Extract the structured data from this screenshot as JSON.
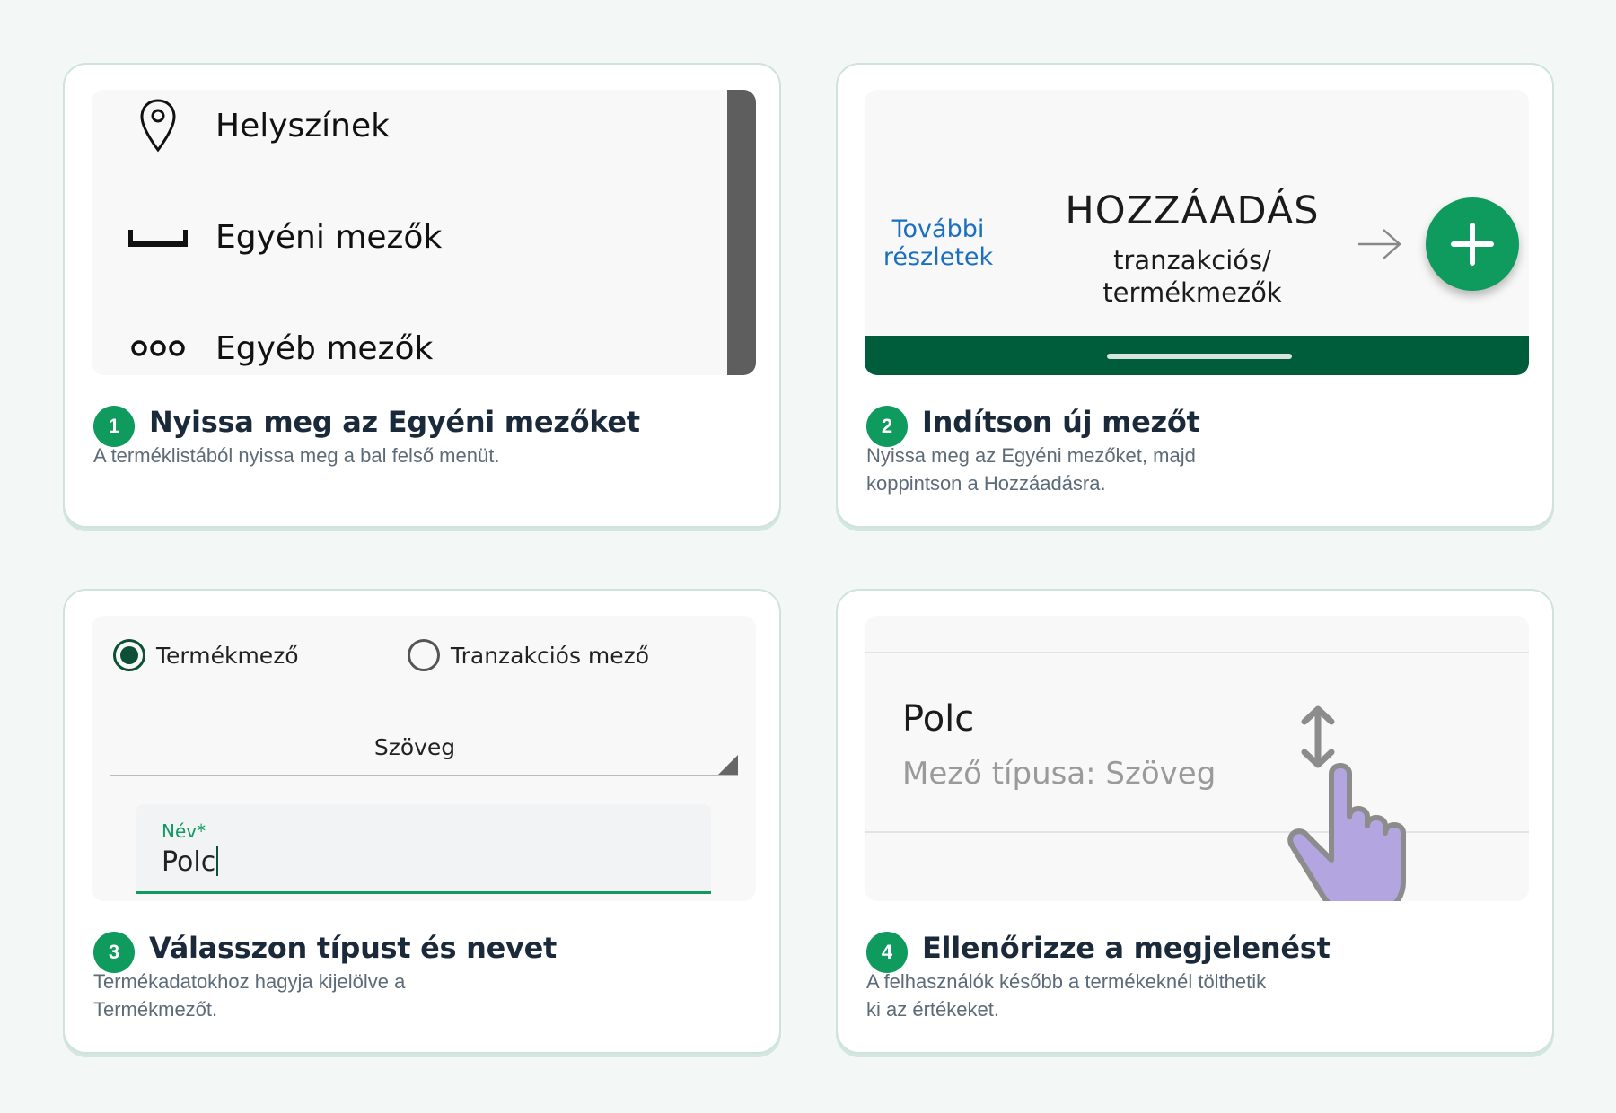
{
  "steps": [
    {
      "number": "1",
      "title": "Nyissa meg az Egyéni mezőket",
      "description": "A terméklistából nyissa meg a bal felső menüt."
    },
    {
      "number": "2",
      "title": "Indítson új mezőt",
      "description": "Nyissa meg az Egyéni mezőket, majd koppintson a Hozzáadásra."
    },
    {
      "number": "3",
      "title": "Válasszon típust és nevet",
      "description": "Termékadatokhoz hagyja kijelölve a Termékmezőt."
    },
    {
      "number": "4",
      "title": "Ellenőrizze a megjelenést",
      "description": "A felhasználók később a termékeknél tölthetik ki az értékeket."
    }
  ],
  "menu": {
    "items": [
      {
        "label": "Helyszínek",
        "icon": "location-pin-icon"
      },
      {
        "label": "Egyéni mezők",
        "icon": "custom-field-icon"
      },
      {
        "label": "Egyéb mezők",
        "icon": "more-dots-icon"
      }
    ]
  },
  "add_screen": {
    "details_link": "További részletek",
    "title": "HOZZÁADÁS",
    "subtitle_line1": "tranzakciós/",
    "subtitle_line2": "termékmezők",
    "fab_icon": "plus-icon",
    "arrow_icon": "arrow-right-icon"
  },
  "form": {
    "radio_product": "Termékmező",
    "radio_transaction": "Tranzakciós mező",
    "selected_radio": "Termékmező",
    "type_value": "Szöveg",
    "name_label": "Név*",
    "name_value": "Polc"
  },
  "preview": {
    "field_name": "Polc",
    "field_type": "Mező típusa: Szöveg",
    "gesture_icon": "drag-hand-icon"
  },
  "colors": {
    "accent": "#0f9a5e",
    "dark_green": "#005d3c",
    "link_blue": "#1b6fc1",
    "hand_purple": "#b3a6e0"
  }
}
